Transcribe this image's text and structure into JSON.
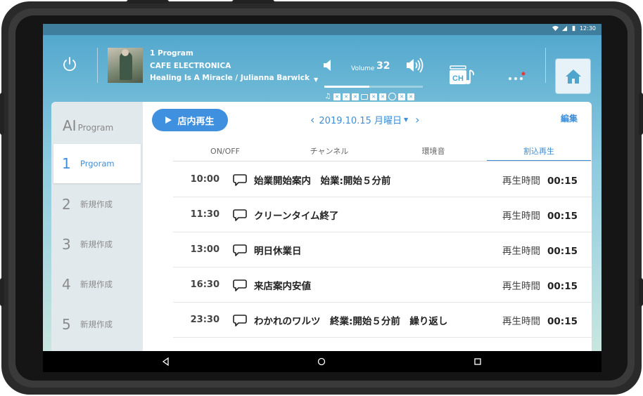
{
  "status_bar": {
    "time": "12:30"
  },
  "player": {
    "program": "1 Program",
    "artist": "CAFE ELECTRONICA",
    "track": "Healing Is A Miracle / Julianna Barwick",
    "volume_label": "Volume",
    "volume_value": "32",
    "volume_level": 0.46,
    "mode_icons": [
      "note-icon",
      "x-box",
      "x-box",
      "x-box",
      "bubble-icon",
      "x-box",
      "x-box",
      "circle-icon",
      "x-box",
      "x-box"
    ]
  },
  "ch_button": {
    "label": "CH"
  },
  "sidebar": {
    "title_big": "AI",
    "title_small": "Program",
    "slots": [
      {
        "num": "1",
        "label": "Prgoram",
        "active": true
      },
      {
        "num": "2",
        "label": "新規作成",
        "active": false
      },
      {
        "num": "3",
        "label": "新規作成",
        "active": false
      },
      {
        "num": "4",
        "label": "新規作成",
        "active": false
      },
      {
        "num": "5",
        "label": "新規作成",
        "active": false
      }
    ]
  },
  "toolbar": {
    "play_label": "店内再生",
    "date": "2019.10.15 月曜日",
    "edit_label": "編集"
  },
  "tabs": [
    {
      "label": "ON/OFF",
      "active": false
    },
    {
      "label": "チャンネル",
      "active": false
    },
    {
      "label": "環境音",
      "active": false
    },
    {
      "label": "割込再生",
      "active": true
    }
  ],
  "schedule": [
    {
      "time": "10:00",
      "title": "始業開始案内　始業:開始５分前",
      "dur_label": "再生時間",
      "dur": "00:15"
    },
    {
      "time": "11:30",
      "title": "クリーンタイム終了",
      "dur_label": "再生時間",
      "dur": "00:15"
    },
    {
      "time": "13:00",
      "title": "明日休業日",
      "dur_label": "再生時間",
      "dur": "00:15"
    },
    {
      "time": "16:30",
      "title": "来店案内安値",
      "dur_label": "再生時間",
      "dur": "00:15"
    },
    {
      "time": "23:30",
      "title": "わかれのワルツ　終業:開始５分前　繰り返し",
      "dur_label": "再生時間",
      "dur": "00:15"
    }
  ],
  "colors": {
    "accent": "#3d8ed6",
    "play_button": "#3f90df",
    "header_top": "#4fa5cc",
    "notification_dot": "#e53935"
  }
}
